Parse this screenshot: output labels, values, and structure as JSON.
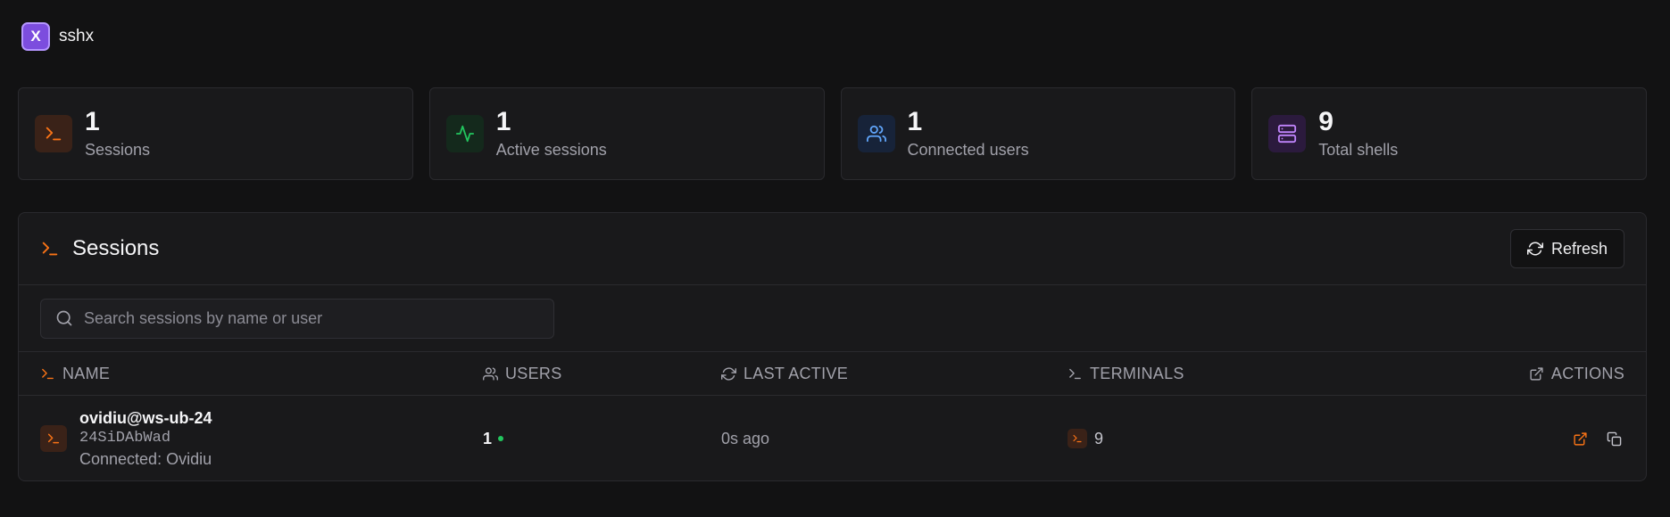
{
  "app": {
    "name": "sshx",
    "logo_letter": "X"
  },
  "stats": [
    {
      "value": "1",
      "label": "Sessions",
      "icon": "terminal-icon",
      "color": "#f97316",
      "bg": "#3a2218"
    },
    {
      "value": "1",
      "label": "Active sessions",
      "icon": "activity-icon",
      "color": "#22c55e",
      "bg": "#14291c"
    },
    {
      "value": "1",
      "label": "Connected users",
      "icon": "users-icon",
      "color": "#60a5fa",
      "bg": "#172339"
    },
    {
      "value": "9",
      "label": "Total shells",
      "icon": "server-icon",
      "color": "#c084fc",
      "bg": "#2b1a3d"
    }
  ],
  "sessions_panel": {
    "title": "Sessions",
    "refresh_label": "Refresh",
    "search_placeholder": "Search sessions by name or user",
    "columns": {
      "name": "NAME",
      "users": "USERS",
      "last_active": "LAST ACTIVE",
      "terminals": "TERMINALS",
      "actions": "ACTIONS"
    },
    "rows": [
      {
        "host": "ovidiu@ws-ub-24",
        "id": "24SiDAbWad",
        "connected": "Connected: Ovidiu",
        "users": "1",
        "users_status_color": "#22c55e",
        "last_active": "0s ago",
        "terminals": "9"
      }
    ]
  },
  "colors": {
    "accent_orange": "#f97316",
    "brand_purple": "#7c4dde",
    "background": "#121213",
    "card": "#19191b"
  }
}
